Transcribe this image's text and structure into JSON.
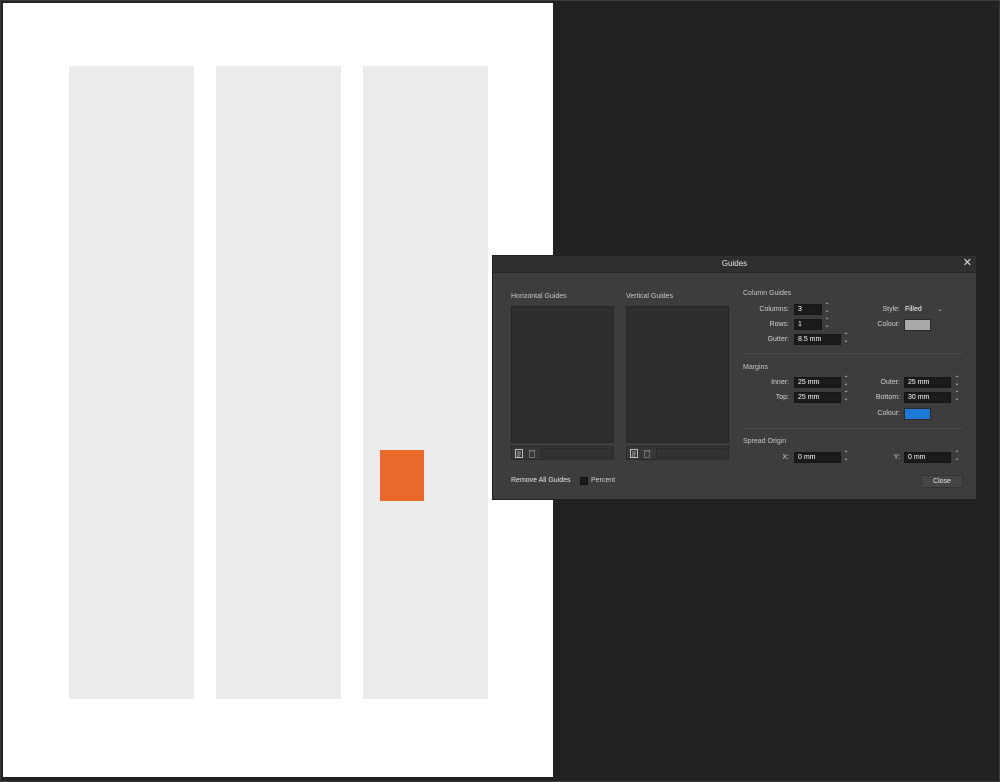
{
  "dialog": {
    "title": "Guides",
    "horizontal_guides_label": "Horizontal Guides",
    "vertical_guides_label": "Vertical Guides",
    "column_guides": {
      "heading": "Column Guides",
      "columns_label": "Columns:",
      "columns_value": "3",
      "rows_label": "Rows:",
      "rows_value": "1",
      "gutter_label": "Gutter:",
      "gutter_value": "8.5 mm",
      "style_label": "Style:",
      "style_value": "Filled",
      "colour_label": "Colour:",
      "colour_swatch": "#a8a8a8"
    },
    "margins": {
      "heading": "Margins",
      "inner_label": "Inner:",
      "inner_value": "25 mm",
      "top_label": "Top:",
      "top_value": "25 mm",
      "outer_label": "Outer:",
      "outer_value": "25 mm",
      "bottom_label": "Bottom:",
      "bottom_value": "30 mm",
      "colour_label": "Colour:",
      "colour_swatch": "#1e78d6"
    },
    "spread_origin": {
      "heading": "Spread Origin",
      "x_label": "X:",
      "x_value": "0 mm",
      "y_label": "Y:",
      "y_value": "0 mm"
    },
    "remove_all_label": "Remove All Guides",
    "percent_label": "Percent",
    "close_label": "Close",
    "close_glyph": "✕"
  },
  "canvas": {
    "page_color": "#ffffff",
    "column_color": "#ebebeb",
    "shape_color": "#e8692a"
  }
}
